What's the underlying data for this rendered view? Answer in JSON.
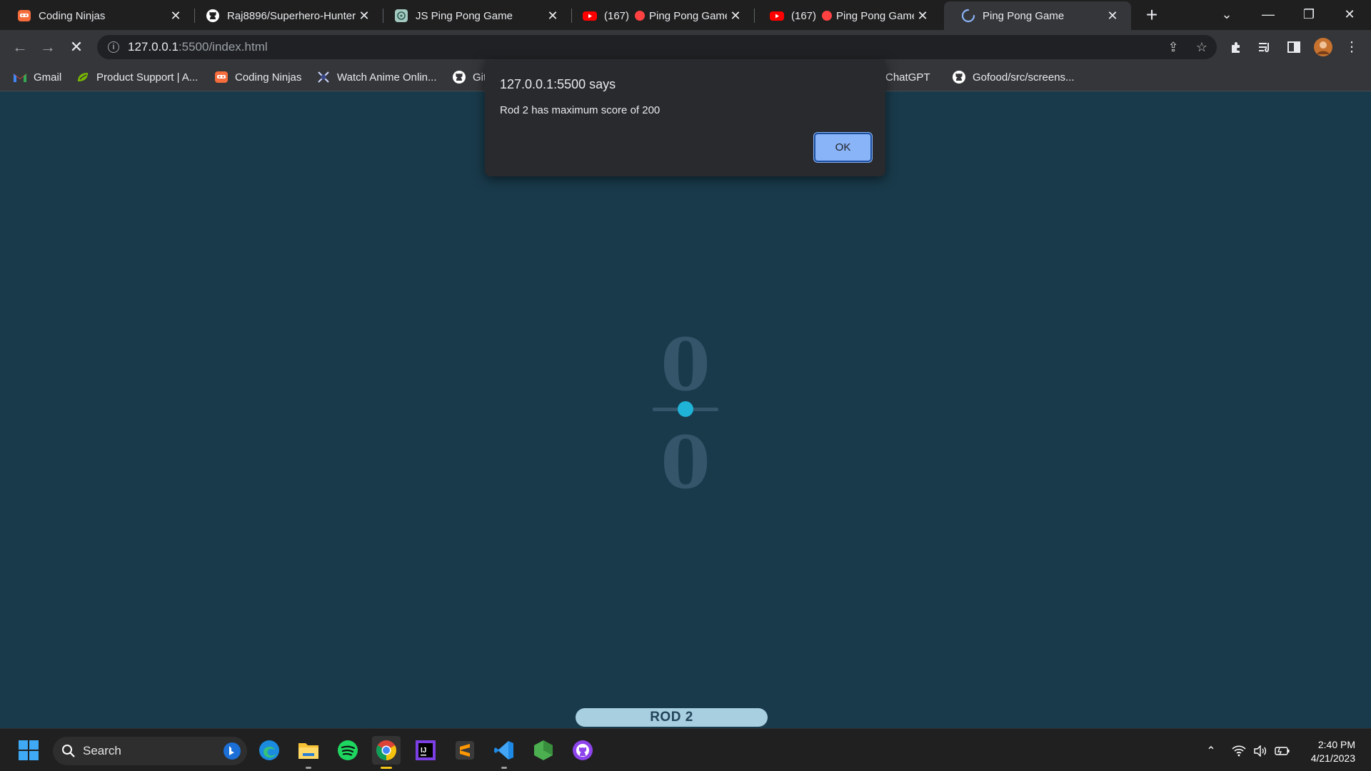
{
  "tabs": [
    {
      "title": "Coding Ninjas",
      "icon": "coding-ninjas-icon"
    },
    {
      "title": "Raj8896/Superhero-Hunter",
      "icon": "github-icon"
    },
    {
      "title": "JS Ping Pong Game",
      "icon": "chatgpt-icon"
    },
    {
      "title": "(167)",
      "title_after": "Ping Pong Game |",
      "icon": "youtube-icon"
    },
    {
      "title": "(167)",
      "title_after": "Ping Pong Game |",
      "icon": "youtube-icon"
    },
    {
      "title": "Ping Pong Game",
      "icon": "loading-spinner-icon",
      "active": true
    }
  ],
  "address": {
    "host": "127.0.0.1",
    "rest": ":5500/index.html"
  },
  "bookmarks": [
    {
      "label": "Gmail",
      "icon": "gmail-icon"
    },
    {
      "label": "Product Support | A...",
      "icon": "product-support-icon"
    },
    {
      "label": "Coding Ninjas",
      "icon": "coding-ninjas-icon"
    },
    {
      "label": "Watch Anime Onlin...",
      "icon": "anime-icon"
    },
    {
      "label": "Git",
      "icon": "github-icon"
    },
    {
      "label": "ChatGPT",
      "icon": "chatgpt-icon"
    },
    {
      "label": "Gofood/src/screens...",
      "icon": "github-icon"
    }
  ],
  "game": {
    "score_top": "0",
    "score_bottom": "0",
    "rod_label": "ROD 2"
  },
  "dialog": {
    "title": "127.0.0.1:5500 says",
    "message": "Rod 2 has maximum score of 200",
    "ok_label": "OK"
  },
  "taskbar": {
    "search_label": "Search",
    "time": "2:40 PM",
    "date": "4/21/2023"
  },
  "colors": {
    "page_bg": "#193a4b",
    "score": "#35556a",
    "ball": "#1fb3d8",
    "rod": "#a7cfe0",
    "ok_button": "#8ab4f8"
  }
}
